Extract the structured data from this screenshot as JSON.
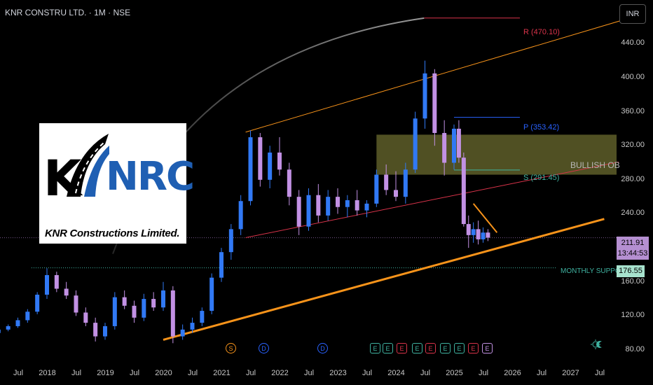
{
  "header": {
    "symbol_line": "KNR CONSTRU LTD. · 1M · NSE",
    "currency_button": "INR"
  },
  "price_axis": {
    "ticks": [
      "440.00",
      "400.00",
      "360.00",
      "320.00",
      "280.00",
      "240.00",
      "160.00",
      "120.00",
      "80.00"
    ]
  },
  "time_axis": {
    "ticks": [
      "Jul",
      "2018",
      "Jul",
      "2019",
      "Jul",
      "2020",
      "Jul",
      "2021",
      "Jul",
      "2022",
      "Jul",
      "2023",
      "Jul",
      "2024",
      "Jul",
      "2025",
      "Jul",
      "2026",
      "Jul",
      "2027",
      "Jul"
    ]
  },
  "last_price": {
    "price": "211.91",
    "countdown": "13:44:53"
  },
  "support": {
    "label": "MONTHLY SUPPORT",
    "value": "176.55"
  },
  "levels": {
    "resistance": "R (470.10)",
    "pivot": "P (353.42)",
    "support_level": "S (291.45)",
    "zone_label": "BULLISH OB"
  },
  "logo": {
    "brand": "NRC",
    "letter": "K",
    "company": "KNR Constructions Limited."
  },
  "events": [
    "S",
    "D",
    "D",
    "E",
    "E",
    "E",
    "E",
    "E",
    "E",
    "E",
    "E",
    "E"
  ],
  "colors": {
    "up": "#3179f5",
    "down": "#c291e4",
    "trend": "#f7931a",
    "red_line": "#d9334a",
    "ob_zone": "#6b6b2f",
    "pivot": "#2962ff",
    "support_green": "#3fb2a0"
  },
  "chart_data": {
    "type": "candlestick",
    "title": "KNR CONSTRU LTD. · 1M · NSE",
    "ylim": [
      78,
      470
    ],
    "x_range": [
      "2017-03",
      "2027-09"
    ],
    "log_scale": false,
    "grid": false,
    "candles": [
      {
        "t": "2017-03",
        "o": 100,
        "h": 106,
        "l": 98,
        "c": 104
      },
      {
        "t": "2017-05",
        "o": 104,
        "h": 110,
        "l": 102,
        "c": 108
      },
      {
        "t": "2017-07",
        "o": 108,
        "h": 118,
        "l": 106,
        "c": 115
      },
      {
        "t": "2017-09",
        "o": 115,
        "h": 128,
        "l": 112,
        "c": 125
      },
      {
        "t": "2017-11",
        "o": 125,
        "h": 148,
        "l": 122,
        "c": 145
      },
      {
        "t": "2018-01",
        "o": 145,
        "h": 176,
        "l": 140,
        "c": 168
      },
      {
        "t": "2018-03",
        "o": 168,
        "h": 172,
        "l": 148,
        "c": 152
      },
      {
        "t": "2018-05",
        "o": 152,
        "h": 160,
        "l": 140,
        "c": 144
      },
      {
        "t": "2018-07",
        "o": 144,
        "h": 150,
        "l": 120,
        "c": 124
      },
      {
        "t": "2018-09",
        "o": 124,
        "h": 130,
        "l": 108,
        "c": 112
      },
      {
        "t": "2018-11",
        "o": 112,
        "h": 118,
        "l": 90,
        "c": 96
      },
      {
        "t": "2019-01",
        "o": 96,
        "h": 112,
        "l": 92,
        "c": 108
      },
      {
        "t": "2019-03",
        "o": 108,
        "h": 148,
        "l": 104,
        "c": 142
      },
      {
        "t": "2019-05",
        "o": 142,
        "h": 150,
        "l": 128,
        "c": 132
      },
      {
        "t": "2019-07",
        "o": 132,
        "h": 138,
        "l": 112,
        "c": 118
      },
      {
        "t": "2019-09",
        "o": 118,
        "h": 146,
        "l": 114,
        "c": 140
      },
      {
        "t": "2019-11",
        "o": 140,
        "h": 148,
        "l": 126,
        "c": 130
      },
      {
        "t": "2020-01",
        "o": 130,
        "h": 160,
        "l": 126,
        "c": 150
      },
      {
        "t": "2020-03",
        "o": 150,
        "h": 155,
        "l": 88,
        "c": 96
      },
      {
        "t": "2020-05",
        "o": 96,
        "h": 110,
        "l": 92,
        "c": 104
      },
      {
        "t": "2020-07",
        "o": 104,
        "h": 118,
        "l": 100,
        "c": 112
      },
      {
        "t": "2020-09",
        "o": 112,
        "h": 130,
        "l": 108,
        "c": 126
      },
      {
        "t": "2020-11",
        "o": 126,
        "h": 170,
        "l": 122,
        "c": 165
      },
      {
        "t": "2021-01",
        "o": 165,
        "h": 200,
        "l": 160,
        "c": 195
      },
      {
        "t": "2021-03",
        "o": 195,
        "h": 228,
        "l": 186,
        "c": 222
      },
      {
        "t": "2021-05",
        "o": 222,
        "h": 262,
        "l": 215,
        "c": 255
      },
      {
        "t": "2021-07",
        "o": 255,
        "h": 338,
        "l": 250,
        "c": 330
      },
      {
        "t": "2021-09",
        "o": 330,
        "h": 335,
        "l": 272,
        "c": 280
      },
      {
        "t": "2021-11",
        "o": 280,
        "h": 320,
        "l": 270,
        "c": 312
      },
      {
        "t": "2022-01",
        "o": 312,
        "h": 330,
        "l": 285,
        "c": 292
      },
      {
        "t": "2022-03",
        "o": 292,
        "h": 300,
        "l": 250,
        "c": 260
      },
      {
        "t": "2022-05",
        "o": 260,
        "h": 268,
        "l": 215,
        "c": 225
      },
      {
        "t": "2022-07",
        "o": 225,
        "h": 270,
        "l": 220,
        "c": 262
      },
      {
        "t": "2022-09",
        "o": 262,
        "h": 275,
        "l": 230,
        "c": 238
      },
      {
        "t": "2022-11",
        "o": 238,
        "h": 268,
        "l": 232,
        "c": 260
      },
      {
        "t": "2023-01",
        "o": 260,
        "h": 270,
        "l": 240,
        "c": 248
      },
      {
        "t": "2023-03",
        "o": 248,
        "h": 262,
        "l": 236,
        "c": 256
      },
      {
        "t": "2023-05",
        "o": 256,
        "h": 268,
        "l": 238,
        "c": 244
      },
      {
        "t": "2023-07",
        "o": 244,
        "h": 256,
        "l": 236,
        "c": 252
      },
      {
        "t": "2023-09",
        "o": 252,
        "h": 292,
        "l": 248,
        "c": 286
      },
      {
        "t": "2023-11",
        "o": 286,
        "h": 298,
        "l": 262,
        "c": 268
      },
      {
        "t": "2024-01",
        "o": 268,
        "h": 290,
        "l": 255,
        "c": 260
      },
      {
        "t": "2024-03",
        "o": 260,
        "h": 300,
        "l": 252,
        "c": 292
      },
      {
        "t": "2024-05",
        "o": 292,
        "h": 360,
        "l": 288,
        "c": 352
      },
      {
        "t": "2024-07",
        "o": 352,
        "h": 420,
        "l": 340,
        "c": 405
      },
      {
        "t": "2024-09",
        "o": 405,
        "h": 410,
        "l": 320,
        "c": 335
      },
      {
        "t": "2024-11",
        "o": 335,
        "h": 350,
        "l": 285,
        "c": 300
      },
      {
        "t": "2025-01",
        "o": 300,
        "h": 345,
        "l": 292,
        "c": 340
      },
      {
        "t": "2025-02",
        "o": 340,
        "h": 350,
        "l": 300,
        "c": 306
      },
      {
        "t": "2025-03",
        "o": 306,
        "h": 312,
        "l": 225,
        "c": 228
      },
      {
        "t": "2025-04",
        "o": 228,
        "h": 238,
        "l": 200,
        "c": 215
      },
      {
        "t": "2025-05",
        "o": 215,
        "h": 230,
        "l": 206,
        "c": 222
      },
      {
        "t": "2025-06",
        "o": 222,
        "h": 232,
        "l": 204,
        "c": 210
      },
      {
        "t": "2025-07",
        "o": 210,
        "h": 224,
        "l": 206,
        "c": 218
      },
      {
        "t": "2025-08",
        "o": 218,
        "h": 222,
        "l": 208,
        "c": 212
      }
    ],
    "lines": {
      "orange_channel_top": [
        [
          "2021-06",
          336
        ],
        [
          "2027-12",
          468
        ]
      ],
      "orange_support": [
        [
          "2020-01",
          92
        ],
        [
          "2027-08",
          234
        ]
      ],
      "red_trend": [
        [
          "2021-06",
          212
        ],
        [
          "2027-11",
          301
        ]
      ],
      "resistance_R": 470.1,
      "pivot_P": 353.42,
      "support_S": 291.45,
      "monthly_support": 176.55,
      "last_price": 211.91
    },
    "zone": {
      "label": "BULLISH OB",
      "from": "2023-09",
      "low": 286,
      "high": 333
    }
  }
}
